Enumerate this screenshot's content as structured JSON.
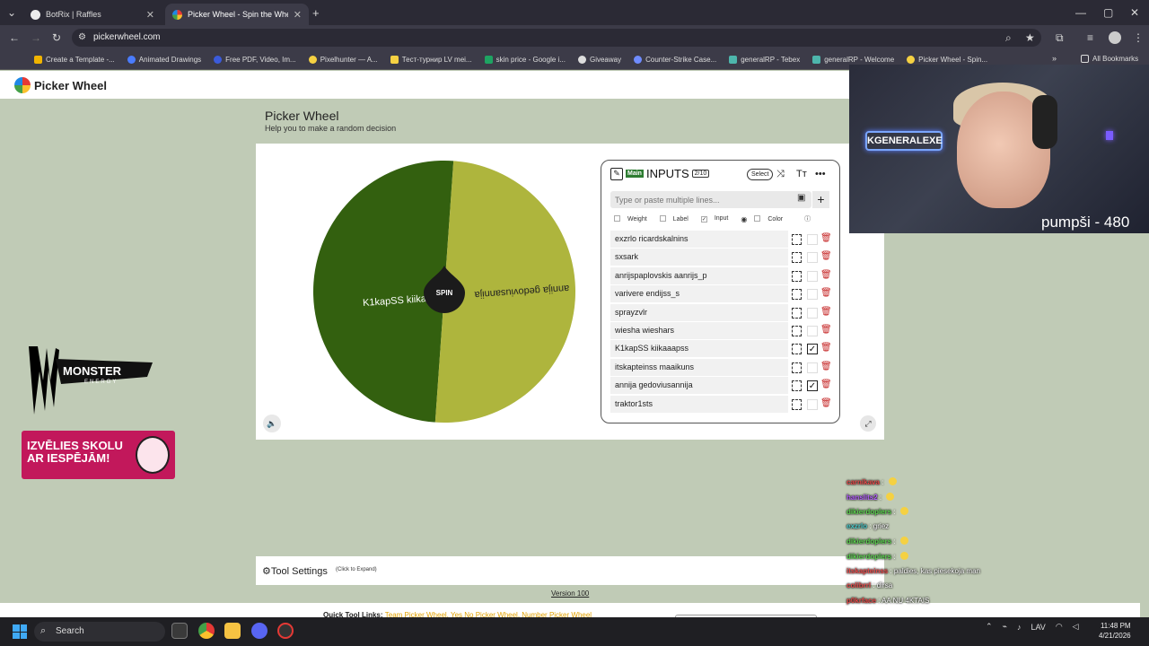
{
  "browser": {
    "tabs": [
      {
        "label": "BotRix | Raffles",
        "active": false
      },
      {
        "label": "Picker Wheel - Spin the Wheel",
        "active": true
      }
    ],
    "url": "pickerwheel.com",
    "bookmarks": [
      "Create a Template -...",
      "Animated Drawings",
      "Free PDF, Video, Im...",
      "Pixelhunter — A...",
      "Тест-турнир LV mei...",
      "skin price - Google i...",
      "Giveaway",
      "Counter-Strike Case...",
      "generalRP - Tebex",
      "generalRP - Welcome",
      "Picker Wheel - Spin..."
    ],
    "all_bookmarks": "All Bookmarks"
  },
  "site": {
    "logo_text": "Picker Wheel",
    "title": "Picker Wheel",
    "subtitle": "Help you to make a random decision"
  },
  "wheel": {
    "spin_label": "SPIN",
    "segments": [
      {
        "label": "K1kapSS kiikaaapss",
        "color": "#33600f"
      },
      {
        "label": "annija gedoviusannija",
        "color": "#aeb53d"
      }
    ]
  },
  "inputs": {
    "main_badge": "Main",
    "header_label": "INPUTS",
    "count": "2/10",
    "select_label": "Select",
    "placeholder": "Type or paste multiple lines...",
    "options": [
      {
        "label": "Weight",
        "checked": false
      },
      {
        "label": "Label",
        "checked": false
      },
      {
        "label": "Input",
        "checked": true
      },
      {
        "label": "Color",
        "checked": false
      }
    ],
    "entries": [
      {
        "label": "exzrlo ricardskalnins",
        "checked": false
      },
      {
        "label": "sxsark",
        "checked": false
      },
      {
        "label": "anrijspaplovskis  aanrijs_p",
        "checked": false
      },
      {
        "label": "varivere endijss_s",
        "checked": false
      },
      {
        "label": "sprayzvlr",
        "checked": false
      },
      {
        "label": "wiesha wieshars",
        "checked": false
      },
      {
        "label": "K1kapSS kiikaaapss",
        "checked": true
      },
      {
        "label": "itskapteinss maaikuns",
        "checked": false
      },
      {
        "label": "annija gedoviusannija",
        "checked": true
      },
      {
        "label": "traktor1sts",
        "checked": false
      }
    ]
  },
  "tool_settings": {
    "label": "Tool Settings",
    "sub": "(Click to Expand)"
  },
  "version": "Version 100",
  "quick_links": {
    "prefix": "Quick Tool Links:",
    "links": "Team Picker Wheel, Yes No Picker Wheel, Number Picker Wheel"
  },
  "ads": {
    "monster_brand": "MONSTER",
    "monster_sub": "ENERGY",
    "promo_line1": "IZVĒLIES SKOLU",
    "promo_line2": "AR IESPĒJĀM!"
  },
  "stream": {
    "neon_sign": "KGENERALEXE",
    "overlay_text": "pumpši - 480"
  },
  "chat": [
    {
      "user": "carnikava",
      "msg": "",
      "color": "#e84a4a",
      "emote": true
    },
    {
      "user": "hanslits2",
      "msg": "",
      "color": "#b45cff",
      "emote": true
    },
    {
      "user": "dikierdoplers",
      "msg": "",
      "color": "#5bd44e",
      "emote": true
    },
    {
      "user": "exzrlo",
      "msg": "griez",
      "color": "#49c9c9",
      "emote": false
    },
    {
      "user": "dikierdoplers",
      "msg": "",
      "color": "#5bd44e",
      "emote": true
    },
    {
      "user": "dikierdoplers",
      "msg": "",
      "color": "#5bd44e",
      "emote": true
    },
    {
      "user": "itskapteinss",
      "msg": "paldies, kas piesekoja man",
      "color": "#e84a4a",
      "emote": false
    },
    {
      "user": "colibrrl",
      "msg": "dirsa",
      "color": "#e84a4a",
      "emote": false
    },
    {
      "user": "p0krface",
      "msg": "AA NU 4KTAIS",
      "color": "#e84a4a",
      "emote": false
    }
  ],
  "taskbar": {
    "search_placeholder": "Search",
    "lang": "LAV",
    "time": "11:48 PM",
    "date": "4/21/2026"
  },
  "icons": [
    "search-icon",
    "star-icon",
    "extensions-icon",
    "image-icon",
    "plus-icon",
    "shuffle-icon",
    "text-size-icon",
    "more-icon",
    "copy-icon",
    "trash-icon",
    "sound-icon",
    "expand-icon",
    "gear-icon",
    "windows-icon"
  ]
}
